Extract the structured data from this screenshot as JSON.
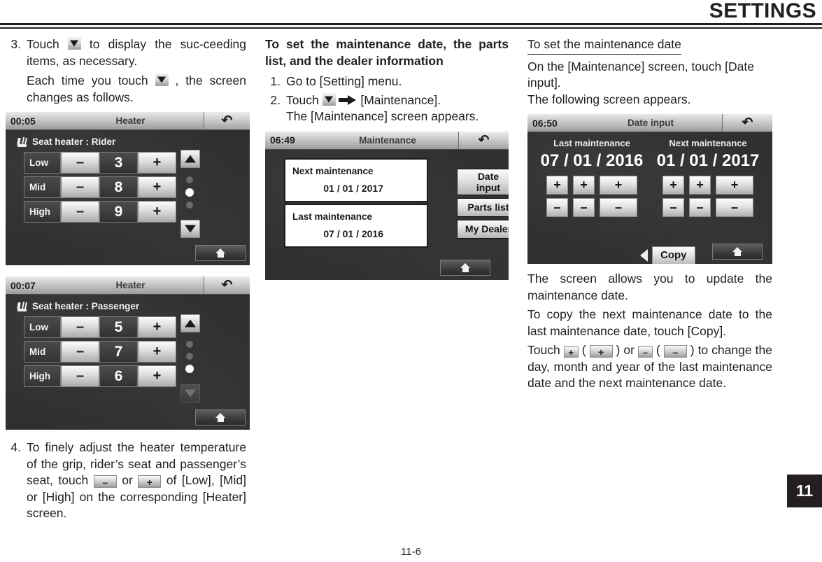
{
  "header": {
    "title": "SETTINGS"
  },
  "footer": {
    "page_number": "11-6"
  },
  "chapter_tab": {
    "number": "11"
  },
  "column1": {
    "step3": {
      "num": "3.",
      "line1_a": "Touch",
      "line1_b": "to display the suc-ceeding items, as necessary.",
      "line2_a": "Each time you touch",
      "line2_b": ", the screen changes as follows."
    },
    "screen_rider": {
      "clock": "00:05",
      "title": "Heater",
      "heading": "Seat heater : Rider",
      "rows": [
        {
          "label": "Low",
          "minus": "–",
          "value": "3",
          "plus": "+"
        },
        {
          "label": "Mid",
          "minus": "–",
          "value": "8",
          "plus": "+"
        },
        {
          "label": "High",
          "minus": "–",
          "value": "9",
          "plus": "+"
        }
      ],
      "dots_active_index": 1,
      "dots_count": 3,
      "up_enabled": true,
      "down_enabled": true
    },
    "screen_passenger": {
      "clock": "00:07",
      "title": "Heater",
      "heading": "Seat heater : Passenger",
      "rows": [
        {
          "label": "Low",
          "minus": "–",
          "value": "5",
          "plus": "+"
        },
        {
          "label": "Mid",
          "minus": "–",
          "value": "7",
          "plus": "+"
        },
        {
          "label": "High",
          "minus": "–",
          "value": "6",
          "plus": "+"
        }
      ],
      "dots_active_index": 2,
      "dots_count": 3,
      "up_enabled": true,
      "down_enabled": false
    },
    "step4": {
      "num": "4.",
      "text_a": "To finely adjust the heater temperature of the grip, rider’s seat and passenger’s seat, touch",
      "minus_chip": "–",
      "text_b": "or",
      "plus_chip": "+",
      "text_c": "of [Low], [Mid] or [High] on the corresponding [Heater] screen."
    }
  },
  "column2": {
    "heading": "To set the maintenance date, the parts list, and the dealer information",
    "step1": {
      "num": "1.",
      "text": "Go to [Setting] menu."
    },
    "step2": {
      "num": "2.",
      "text_a": "Touch",
      "text_b": "[Maintenance].",
      "text_c": "The [Maintenance] screen appears."
    },
    "screen_maintenance": {
      "clock": "06:49",
      "title": "Maintenance",
      "next_label": "Next maintenance",
      "next_date": "01 / 01 / 2017",
      "last_label": "Last maintenance",
      "last_date": "07 / 01 / 2016",
      "buttons": [
        "Date\ninput",
        "Parts list",
        "My Dealer"
      ],
      "button_date_input_line1": "Date",
      "button_date_input_line2": "input",
      "button_parts_list": "Parts list",
      "button_my_dealer": "My Dealer"
    }
  },
  "column3": {
    "heading": "To set the maintenance date",
    "para1": "On the [Maintenance] screen, touch [Date input].",
    "para2": "The following screen appears.",
    "screen_date_input": {
      "clock": "06:50",
      "title": "Date input",
      "last_label": "Last maintenance",
      "last_date": "07 / 01 / 2016",
      "next_label": "Next maintenance",
      "next_date": "01 / 01 / 2017",
      "plus": "+",
      "minus": "–",
      "copy_label": "Copy"
    },
    "para3": "The screen allows you to update the maintenance date.",
    "para4": "To copy the next maintenance date to the last maintenance date, touch [Copy].",
    "para5_a": "Touch",
    "para5_plus_small": "+",
    "para5_open": "(",
    "para5_plus_large": "+",
    "para5_close_or": ") or",
    "para5_minus_small": "–",
    "para5_open2": "(",
    "para5_minus_large": "–",
    "para5_close2": ") to",
    "para5_b": "change the day, month and year of the last maintenance date and the next maintenance date."
  }
}
